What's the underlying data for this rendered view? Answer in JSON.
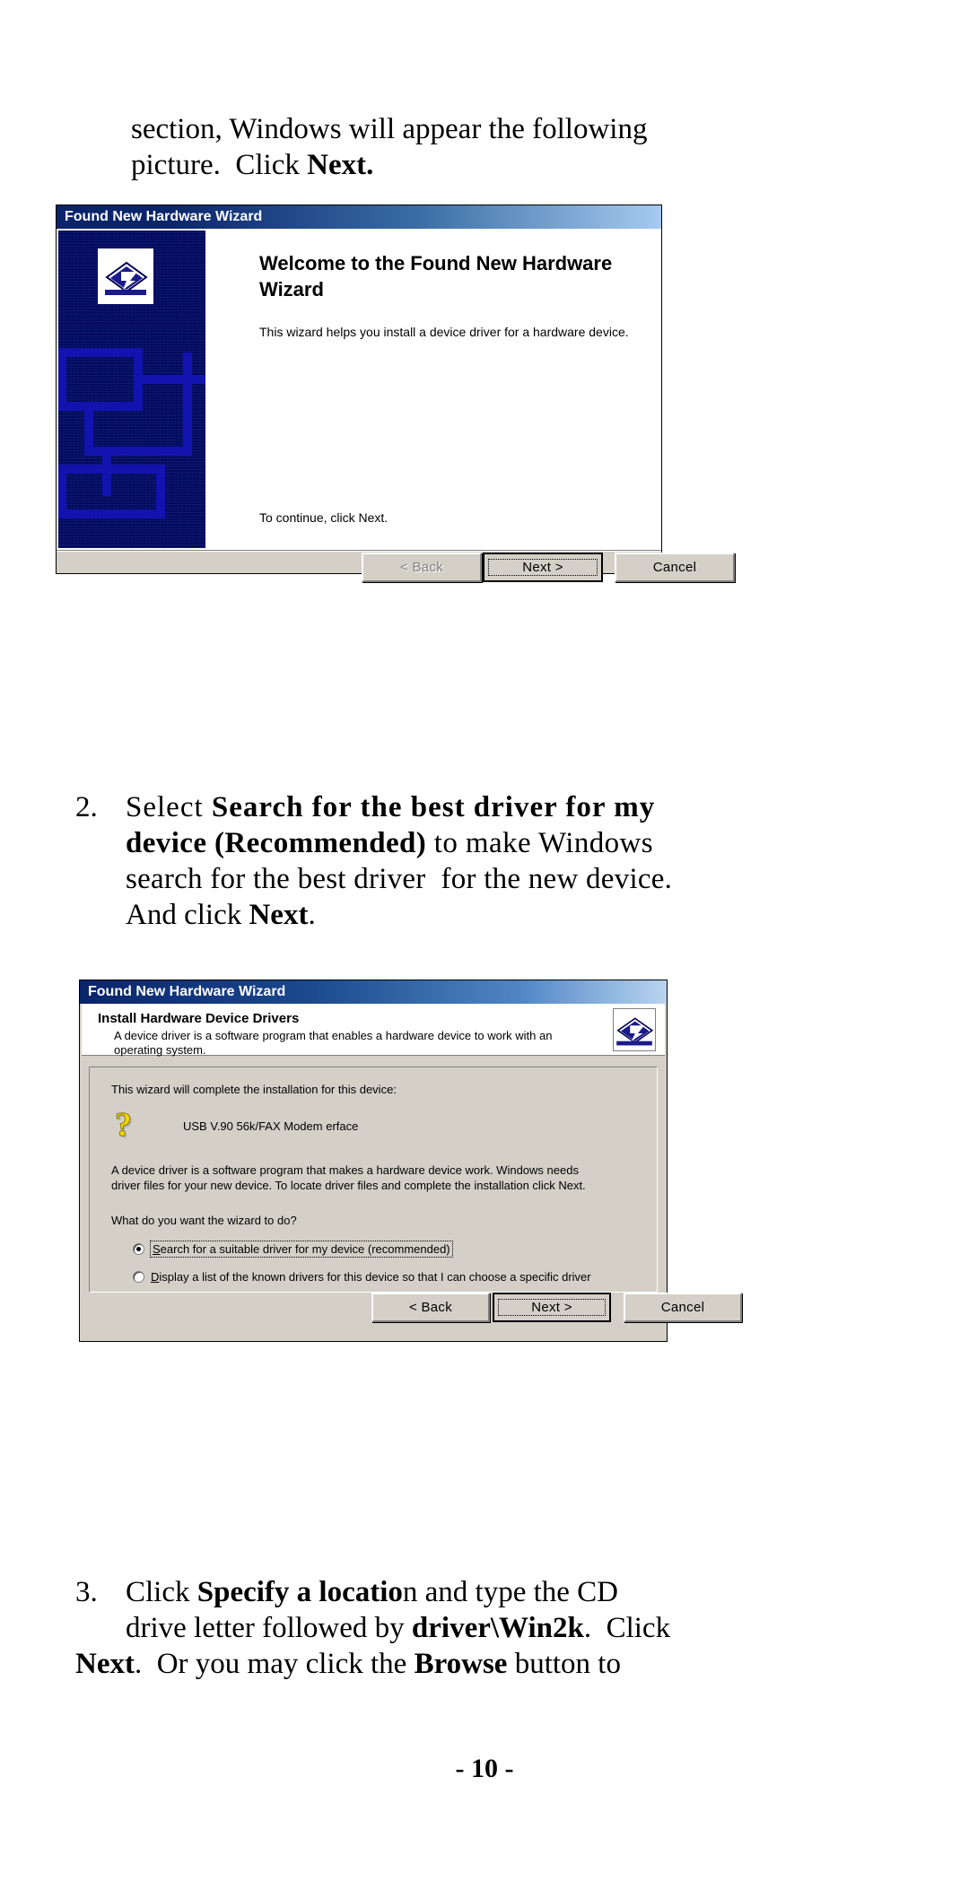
{
  "document": {
    "page_number": "- 10 -",
    "intro_paragraph": {
      "line1": "section, Windows will appear the following",
      "line2_plain": "picture.  Click ",
      "line2_bold": "Next."
    },
    "step2": {
      "number": "2.",
      "line1_plain": "Select ",
      "line1_bold": "Search for the best driver for my",
      "line2_bold": "device (Recommended)",
      "line2_plain": " to make Windows",
      "line3": "search for the best driver  for the new device.",
      "line4_plain": "And click ",
      "line4_bold": "Next",
      "line4_tail": "."
    },
    "step3": {
      "number": "3.",
      "line1_a": "Click ",
      "line1_bold": "Specify a locatio",
      "line1_b": "n and type the CD",
      "line2_a": "drive letter followed by ",
      "line2_bold": "driver\\Win2k",
      "line2_b": ".  Click",
      "line3_bold1": "Next",
      "line3_a": ".  Or you may click the ",
      "line3_bold2": "Browse",
      "line3_b": " button to"
    }
  },
  "dialog1": {
    "title": "Found New Hardware Wizard",
    "icon_name": "hardware-wizard-icon",
    "heading": "Welcome to the Found New Hardware Wizard",
    "description": "This wizard helps you install a device driver for a hardware device.",
    "continue_text": "To continue, click Next.",
    "buttons": {
      "back": "< Back",
      "back_enabled": false,
      "next": "Next >",
      "next_default": true,
      "cancel": "Cancel"
    }
  },
  "dialog2": {
    "title": "Found New Hardware Wizard",
    "header": {
      "title": "Install Hardware Device Drivers",
      "subtitle": "A device driver is a software program that enables a hardware device to work with an operating system.",
      "icon_name": "hardware-wizard-icon"
    },
    "body": {
      "intro": "This wizard will complete the installation for this device:",
      "device_icon_name": "unknown-device-question-icon",
      "device_name": "USB V.90 56k/FAX Modem erface",
      "paragraph_line1": "A device driver is a software program that makes a hardware device work. Windows needs",
      "paragraph_line2": "driver files for your new device. To locate driver files and complete the installation click Next.",
      "question": "What do you want the wizard to do?",
      "options": [
        {
          "label_accel": "S",
          "label_before": "",
          "label_after": "earch for a suitable driver for my device (recommended)",
          "selected": true,
          "focused": true
        },
        {
          "label_accel": "D",
          "label_before": "",
          "label_after": "isplay a list of the known drivers for this device so that I can choose a specific driver",
          "selected": false,
          "focused": false
        }
      ]
    },
    "buttons": {
      "back": "< Back",
      "back_enabled": true,
      "next": "Next >",
      "next_default": true,
      "cancel": "Cancel"
    }
  },
  "colors": {
    "title_bar_start": "#0a246a",
    "title_bar_end": "#a6caf0",
    "dialog_face": "#d4d0c8",
    "banner_blue": "#000a5e",
    "device_icon_yellow": "#f5d800"
  }
}
